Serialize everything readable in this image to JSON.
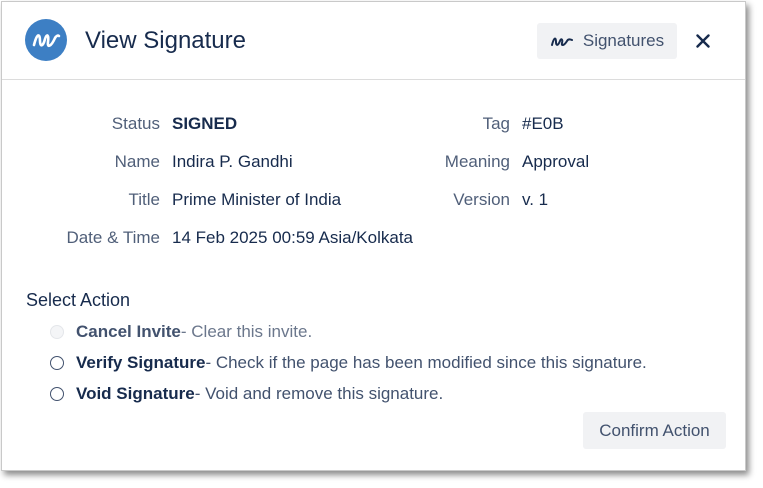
{
  "dialog": {
    "title": "View Signature",
    "signatures_button": "Signatures",
    "close_icon": "close-icon",
    "logo_icon": "signature-scribble-icon"
  },
  "details": {
    "status_label": "Status",
    "status_value": "SIGNED",
    "name_label": "Name",
    "name_value": "Indira P. Gandhi",
    "title_label": "Title",
    "title_value": "Prime Minister of India",
    "datetime_label": "Date & Time",
    "datetime_value": "14 Feb 2025 00:59 Asia/Kolkata",
    "tag_label": "Tag",
    "tag_value": "#E0B",
    "meaning_label": "Meaning",
    "meaning_value": "Approval",
    "version_label": "Version",
    "version_value": "v. 1"
  },
  "actions": {
    "heading": "Select Action",
    "options": [
      {
        "name": "Cancel Invite",
        "description": " - Clear this invite.",
        "disabled": true,
        "selected": false
      },
      {
        "name": "Verify Signature",
        "description": " - Check if the page has been modified since this signature.",
        "disabled": false,
        "selected": false
      },
      {
        "name": "Void Signature",
        "description": " - Void and remove this signature.",
        "disabled": false,
        "selected": false
      }
    ],
    "confirm_button": "Confirm Action"
  },
  "colors": {
    "logo_bg": "#3d7fc4",
    "text_primary": "#172b4d",
    "button_bg": "#f1f2f4"
  }
}
